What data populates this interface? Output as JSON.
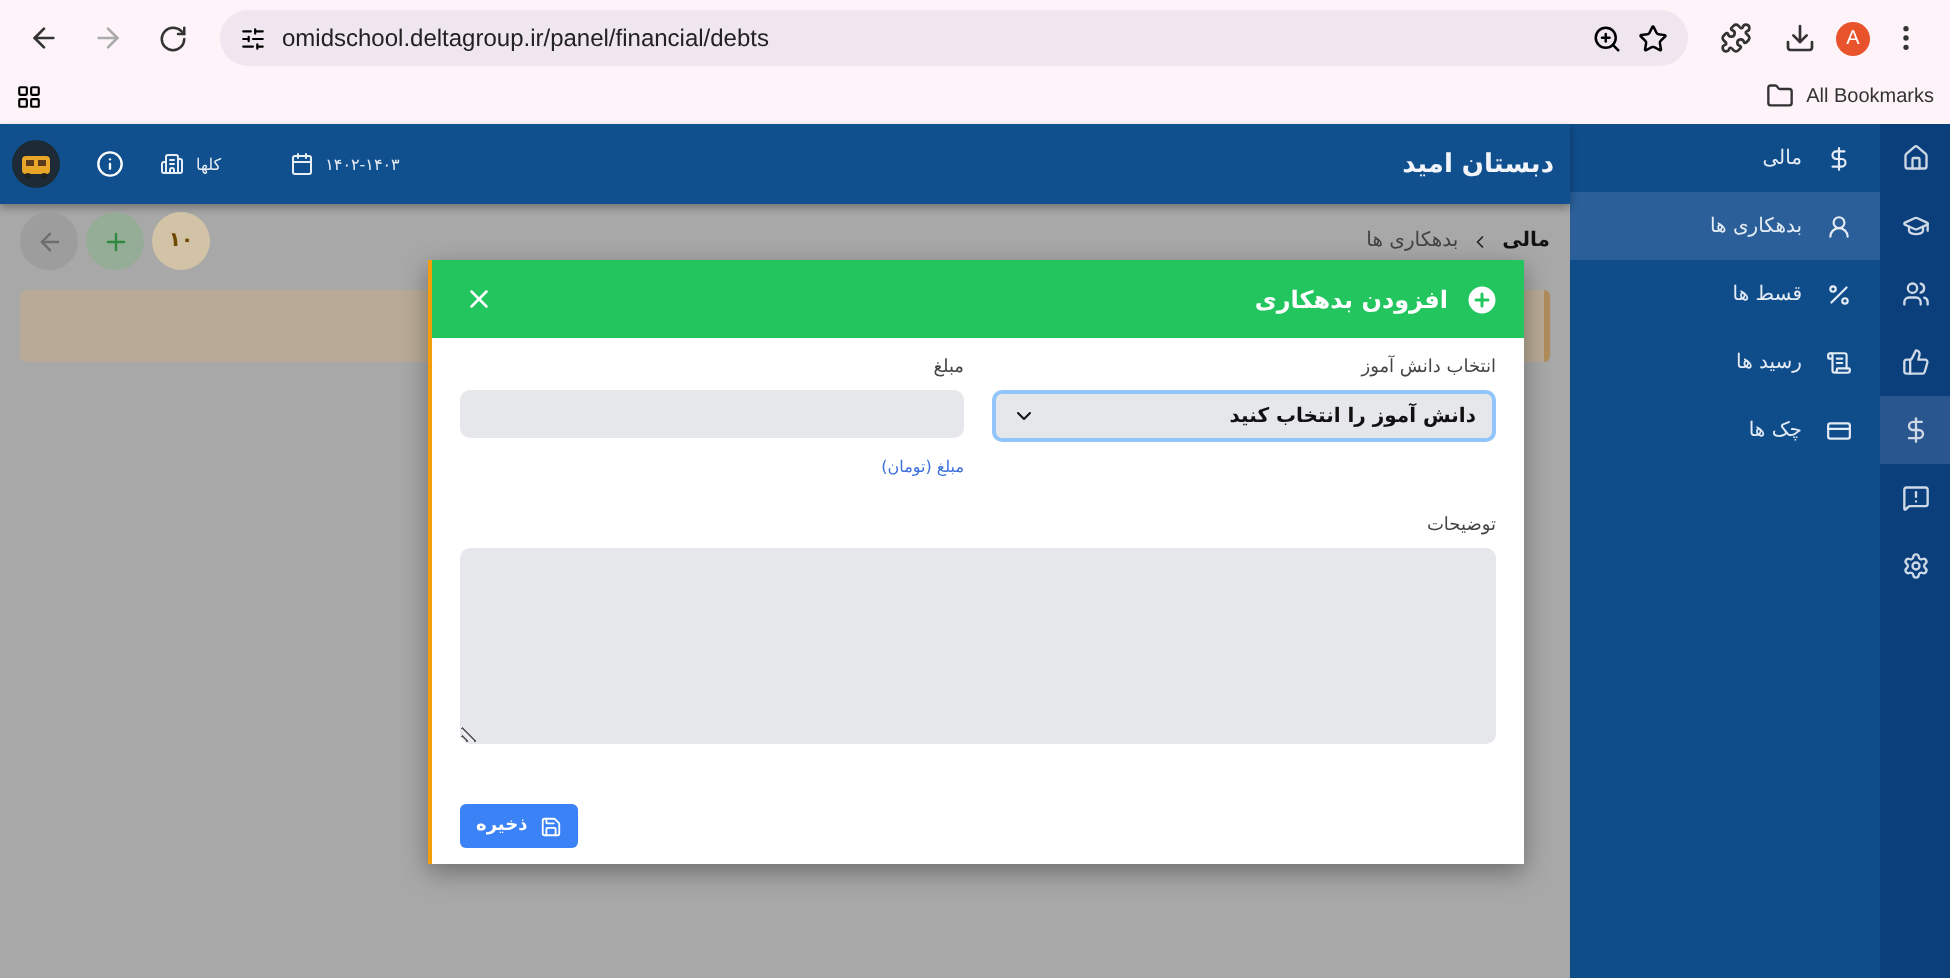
{
  "browser": {
    "url": "omidschool.deltagroup.ir/panel/financial/debts",
    "profile_initial": "A",
    "bookmarks_label": "All Bookmarks"
  },
  "header": {
    "school_name": "دبستان امید",
    "branch_label": "کلها",
    "date_range": "۱۴۰۲-۱۴۰۳"
  },
  "toolbar": {
    "count_badge": "۱۰"
  },
  "breadcrumb": [
    "مالی",
    "بدهکاری ها"
  ],
  "sidebar": {
    "section_title": "مالی",
    "items": [
      {
        "label": "بدهکاری ها",
        "selected": true
      },
      {
        "label": "قسط ها",
        "selected": false
      },
      {
        "label": "رسید ها",
        "selected": false
      },
      {
        "label": "چک ها",
        "selected": false
      }
    ]
  },
  "rail": [
    {
      "selected": false
    },
    {
      "selected": false
    },
    {
      "selected": false
    },
    {
      "selected": false
    },
    {
      "selected": true
    },
    {
      "selected": false
    },
    {
      "selected": false
    }
  ],
  "modal": {
    "title": "افزودن بدهکاری",
    "student_label": "انتخاب دانش آموز",
    "student_select": "دانش آموز را انتخاب کنید",
    "amount_label": "مبلغ",
    "amount_hint": "مبلغ (تومان)",
    "description_label": "توضیحات",
    "save_button": "ذخیره"
  }
}
